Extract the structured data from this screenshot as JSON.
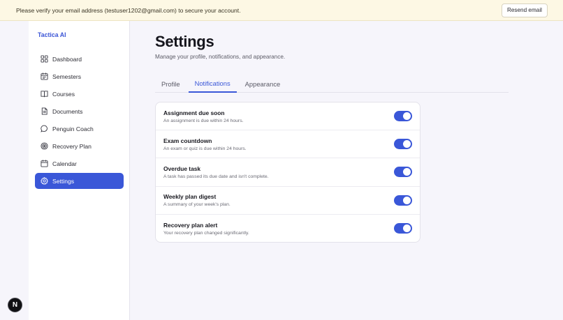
{
  "banner": {
    "message": "Please verify your email address (testuser1202@gmail.com) to secure your account.",
    "resend_label": "Resend email"
  },
  "sidebar": {
    "brand": "Tactica AI",
    "items": [
      {
        "label": "Dashboard",
        "icon": "dashboard-icon"
      },
      {
        "label": "Semesters",
        "icon": "calendar-grid-icon"
      },
      {
        "label": "Courses",
        "icon": "book-icon"
      },
      {
        "label": "Documents",
        "icon": "document-icon"
      },
      {
        "label": "Penguin Coach",
        "icon": "chat-bubble-icon"
      },
      {
        "label": "Recovery Plan",
        "icon": "target-icon"
      },
      {
        "label": "Calendar",
        "icon": "calendar-icon"
      },
      {
        "label": "Settings",
        "icon": "gear-icon",
        "active": true
      }
    ]
  },
  "page": {
    "title": "Settings",
    "subtitle": "Manage your profile, notifications, and appearance."
  },
  "tabs": [
    {
      "label": "Profile"
    },
    {
      "label": "Notifications",
      "active": true
    },
    {
      "label": "Appearance"
    }
  ],
  "notifications": [
    {
      "title": "Assignment due soon",
      "description": "An assignment is due within 24 hours.",
      "enabled": true
    },
    {
      "title": "Exam countdown",
      "description": "An exam or quiz is due within 24 hours.",
      "enabled": true
    },
    {
      "title": "Overdue task",
      "description": "A task has passed its due date and isn't complete.",
      "enabled": true
    },
    {
      "title": "Weekly plan digest",
      "description": "A summary of your week's plan.",
      "enabled": true
    },
    {
      "title": "Recovery plan alert",
      "description": "Your recovery plan changed significantly.",
      "enabled": true
    }
  ],
  "badge": {
    "letter": "N"
  },
  "colors": {
    "accent": "#3a57d8",
    "banner_bg": "#fdf8e4",
    "page_bg": "#f6f5fb"
  }
}
